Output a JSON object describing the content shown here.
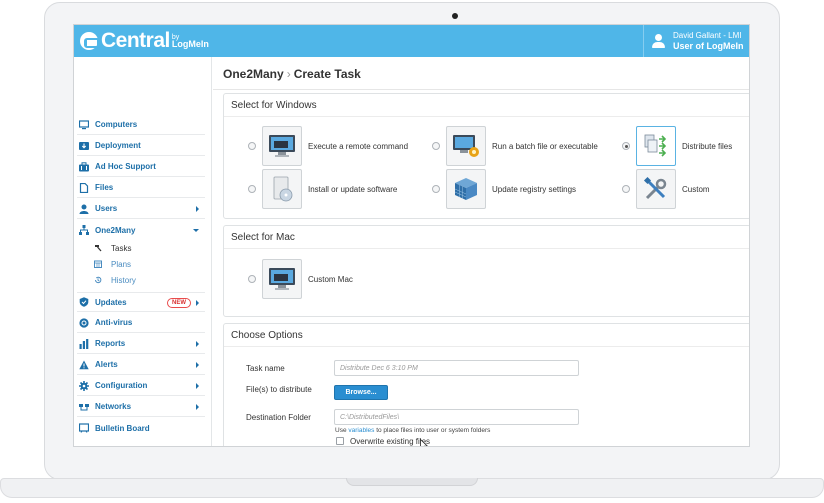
{
  "app": {
    "brand": "Central",
    "brand_by": "by",
    "brand_company": "LogMeIn",
    "user_name": "David Gallant - LMI",
    "user_org": "User of LogMeIn"
  },
  "sidebar": {
    "items": [
      {
        "label": "Computers",
        "icon": "monitor-icon",
        "arrow": false
      },
      {
        "label": "Deployment",
        "icon": "download-icon",
        "arrow": false
      },
      {
        "label": "Ad Hoc Support",
        "icon": "briefcase-icon",
        "arrow": false
      },
      {
        "label": "Files",
        "icon": "file-icon",
        "arrow": false
      },
      {
        "label": "Users",
        "icon": "user-icon",
        "arrow": true
      },
      {
        "label": "One2Many",
        "icon": "hierarchy-icon",
        "arrow": true,
        "expanded": true
      },
      {
        "label": "Updates",
        "icon": "shield-icon",
        "arrow": true,
        "badge": "NEW"
      },
      {
        "label": "Anti-virus",
        "icon": "antivirus-icon",
        "arrow": false
      },
      {
        "label": "Reports",
        "icon": "bar-chart-icon",
        "arrow": true
      },
      {
        "label": "Alerts",
        "icon": "warning-icon",
        "arrow": true
      },
      {
        "label": "Configuration",
        "icon": "gear-icon",
        "arrow": true
      },
      {
        "label": "Networks",
        "icon": "network-icon",
        "arrow": true
      },
      {
        "label": "Bulletin Board",
        "icon": "board-icon",
        "arrow": false
      }
    ],
    "sub_items": [
      {
        "label": "Tasks",
        "icon": "hammer-icon",
        "active": true
      },
      {
        "label": "Plans",
        "icon": "calendar-icon",
        "active": false
      },
      {
        "label": "History",
        "icon": "history-icon",
        "active": false
      }
    ]
  },
  "main": {
    "breadcrumb_parent": "One2Many",
    "breadcrumb_sep": "›",
    "breadcrumb_current": "Create Task",
    "windows_section": {
      "title": "Select for Windows",
      "options": [
        {
          "label": "Execute a remote command",
          "selected": false
        },
        {
          "label": "Run a batch file or executable",
          "selected": false
        },
        {
          "label": "Distribute files",
          "selected": true
        },
        {
          "label": "Install or update software",
          "selected": false
        },
        {
          "label": "Update registry settings",
          "selected": false
        },
        {
          "label": "Custom",
          "selected": false
        }
      ]
    },
    "mac_section": {
      "title": "Select for Mac",
      "options": [
        {
          "label": "Custom Mac",
          "selected": false
        }
      ]
    },
    "options_section": {
      "title": "Choose Options",
      "task_name_label": "Task name",
      "task_name_placeholder": "Distribute Dec 6 3:10 PM",
      "files_label": "File(s) to distribute",
      "browse_label": "Browse...",
      "destination_label": "Destination Folder",
      "destination_placeholder": "C:\\DistributedFiles\\",
      "hint_prefix": "Use ",
      "hint_link": "variables",
      "hint_suffix": " to place files into user or system folders",
      "overwrite_label": "Overwrite existing files",
      "overwrite_checked": false
    }
  },
  "colors": {
    "header": "#4fb6e8",
    "nav_text": "#1d6fa8",
    "button": "#2a8ed1",
    "badge": "#d83030"
  }
}
